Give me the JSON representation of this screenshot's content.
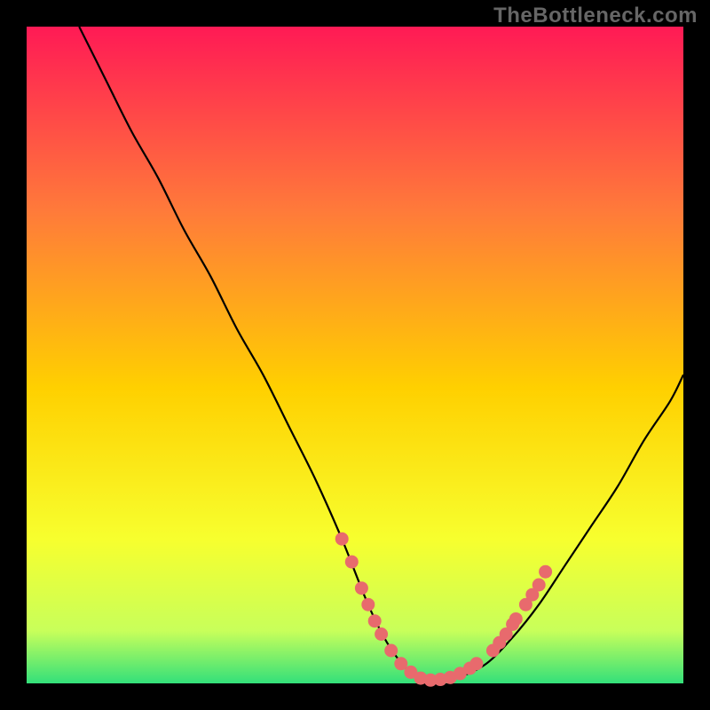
{
  "watermark": "TheBottleneck.com",
  "plot": {
    "inner_x": 30,
    "inner_y": 30,
    "inner_w": 740,
    "inner_h": 740
  },
  "colors": {
    "gradient_top": "#ff1a55",
    "gradient_mid1": "#ff7a3a",
    "gradient_mid2": "#ffd000",
    "gradient_mid3": "#f7ff2e",
    "gradient_bottom1": "#c8ff5a",
    "gradient_bottom2": "#33e07a",
    "curve": "#000000",
    "markers": "#e86a6d"
  },
  "chart_data": {
    "type": "line",
    "title": "",
    "xlabel": "",
    "ylabel": "",
    "xlim": [
      0,
      100
    ],
    "ylim": [
      0,
      100
    ],
    "series": [
      {
        "name": "bottleneck-curve",
        "x": [
          8,
          12,
          16,
          20,
          24,
          28,
          32,
          36,
          40,
          44,
          48,
          52,
          55,
          58,
          60,
          63,
          66,
          70,
          74,
          78,
          82,
          86,
          90,
          94,
          98,
          100
        ],
        "y": [
          100,
          92,
          84,
          77,
          69,
          62,
          54,
          47,
          39,
          31,
          22,
          12,
          6,
          2,
          0.5,
          0.5,
          1,
          3,
          7,
          12,
          18,
          24,
          30,
          37,
          43,
          47
        ]
      }
    ],
    "markers": {
      "name": "highlight-points",
      "points": [
        {
          "x": 48,
          "y": 22
        },
        {
          "x": 49.5,
          "y": 18.5
        },
        {
          "x": 51,
          "y": 14.5
        },
        {
          "x": 52,
          "y": 12
        },
        {
          "x": 53,
          "y": 9.5
        },
        {
          "x": 54,
          "y": 7.5
        },
        {
          "x": 55.5,
          "y": 5
        },
        {
          "x": 57,
          "y": 3
        },
        {
          "x": 58.5,
          "y": 1.7
        },
        {
          "x": 60,
          "y": 0.8
        },
        {
          "x": 61.5,
          "y": 0.5
        },
        {
          "x": 63,
          "y": 0.6
        },
        {
          "x": 64.5,
          "y": 0.9
        },
        {
          "x": 66,
          "y": 1.5
        },
        {
          "x": 67.5,
          "y": 2.3
        },
        {
          "x": 68.5,
          "y": 3
        },
        {
          "x": 71,
          "y": 5
        },
        {
          "x": 72,
          "y": 6.2
        },
        {
          "x": 73,
          "y": 7.5
        },
        {
          "x": 74,
          "y": 9
        },
        {
          "x": 74.5,
          "y": 9.8
        },
        {
          "x": 76,
          "y": 12
        },
        {
          "x": 77,
          "y": 13.5
        },
        {
          "x": 78,
          "y": 15
        },
        {
          "x": 79,
          "y": 17
        }
      ]
    }
  }
}
